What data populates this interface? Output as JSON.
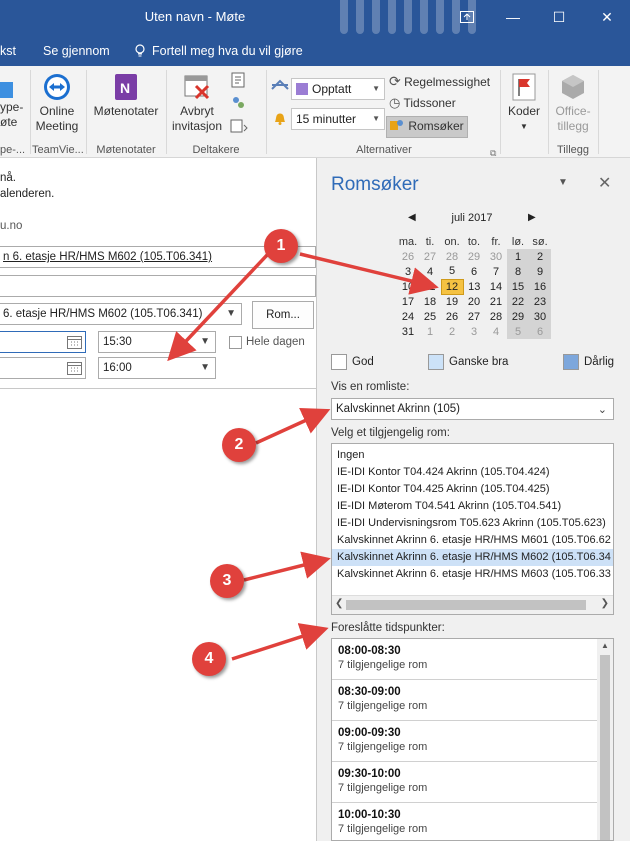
{
  "window": {
    "title": "Uten navn  -  Møte",
    "restore_icon": "restore-ribbon-icon",
    "minimize": "—",
    "maximize": "☐",
    "close": "✕"
  },
  "menu": {
    "items": [
      "kst",
      "Se gjennom"
    ],
    "tell_me": "Fortell meg hva du vil gjøre"
  },
  "ribbon": {
    "teamviewer_partial": [
      "ype-",
      "øte",
      "pe-..."
    ],
    "online_meeting": [
      "Online",
      "Meeting"
    ],
    "teamviewer_group": "TeamVie...",
    "meeting_notes": "Møtenotater",
    "meeting_notes_group": "Møtenotater",
    "cancel_invitation": [
      "Avbryt",
      "invitasjon"
    ],
    "attendees_group": "Deltakere",
    "show_as": "Opptatt",
    "reminder": "15 minutter",
    "recurrence": "Regelmessighet",
    "time_zones": "Tidssoner",
    "room_finder": "Romsøker",
    "options_group": "Alternativer",
    "tags": "Koder",
    "office_addins": [
      "Office-",
      "tillegg"
    ],
    "addins_group": "Tillegg",
    "colors": {
      "show_as_swatch": "#9b7dd4",
      "reminder_bell": "#e8a317",
      "tags_flag": "#d9352c",
      "room_finder_active": "#c9c9c9"
    }
  },
  "form": {
    "info_lines": [
      "nå.",
      "alenderen."
    ],
    "organizer_email": "u.no",
    "to_value": "n 6. etasje HR/HMS M602 (105.T06.341)",
    "subject_value": "",
    "location_value": "6. etasje HR/HMS M602 (105.T06.341)",
    "rooms_button": "Rom...",
    "start_time": "15:30",
    "end_time": "16:00",
    "all_day": "Hele dagen"
  },
  "room_finder": {
    "title": "Romsøker",
    "month": "juli 2017",
    "weekdays": [
      "ma.",
      "ti.",
      "on.",
      "to.",
      "fr.",
      "lø.",
      "sø."
    ],
    "weeks": [
      [
        "26",
        "27",
        "28",
        "29",
        "30",
        "1",
        "2"
      ],
      [
        "3",
        "4",
        "5",
        "6",
        "7",
        "8",
        "9"
      ],
      [
        "10",
        "11",
        "12",
        "13",
        "14",
        "15",
        "16"
      ],
      [
        "17",
        "18",
        "19",
        "20",
        "21",
        "22",
        "23"
      ],
      [
        "24",
        "25",
        "26",
        "27",
        "28",
        "29",
        "30"
      ],
      [
        "31",
        "1",
        "2",
        "3",
        "4",
        "5",
        "6"
      ]
    ],
    "today": "12",
    "legend": [
      {
        "label": "God",
        "color": "#ffffff"
      },
      {
        "label": "Ganske bra",
        "color": "#cce2f8"
      },
      {
        "label": "Dårlig",
        "color": "#7da7dc"
      }
    ],
    "room_list_label": "Vis en romliste:",
    "room_list_value": "Kalvskinnet Akrinn (105)",
    "rooms_label": "Velg et tilgjengelig rom:",
    "rooms": [
      "Ingen",
      "IE-IDI Kontor T04.424 Akrinn (105.T04.424)",
      "IE-IDI Kontor T04.425 Akrinn (105.T04.425)",
      "IE-IDI Møterom T04.541 Akrinn (105.T04.541)",
      "IE-IDI Undervisningsrom T05.623 Akrinn (105.T05.623)",
      "Kalvskinnet Akrinn 6. etasje HR/HMS M601 (105.T06.62",
      "Kalvskinnet Akrinn 6. etasje HR/HMS M602 (105.T06.34",
      "Kalvskinnet Akrinn 6. etasje HR/HMS M603 (105.T06.33"
    ],
    "selected_room_index": 6,
    "suggested_label": "Foreslåtte tidspunkter:",
    "slots": [
      {
        "time": "08:00-08:30",
        "status": "7 tilgjengelige rom"
      },
      {
        "time": "08:30-09:00",
        "status": "7 tilgjengelige rom"
      },
      {
        "time": "09:00-09:30",
        "status": "7 tilgjengelige rom"
      },
      {
        "time": "09:30-10:00",
        "status": "7 tilgjengelige rom"
      },
      {
        "time": "10:00-10:30",
        "status": "7 tilgjengelige rom"
      }
    ]
  },
  "callouts": [
    "1",
    "2",
    "3",
    "4"
  ],
  "callout_color": "#e0413c"
}
